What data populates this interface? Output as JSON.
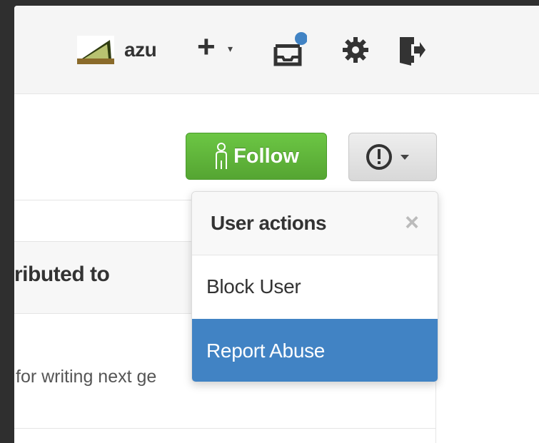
{
  "header": {
    "username": "azu",
    "icons": [
      "avatar",
      "plus-icon",
      "caret-down-icon",
      "inbox-icon",
      "gear-icon",
      "sign-out-icon"
    ],
    "notification_color": "#4183c4"
  },
  "profile_actions": {
    "follow_label": "Follow",
    "follow_color": "#6cc644",
    "actions_icon": "alert-icon"
  },
  "background_content": {
    "contributed_heading": "ributed to",
    "repo_description": "for writing next ge"
  },
  "dropdown": {
    "title": "User actions",
    "close_label": "×",
    "items": [
      {
        "label": "Block User",
        "selected": false
      },
      {
        "label": "Report Abuse",
        "selected": true
      }
    ],
    "selected_color": "#4183c4"
  }
}
